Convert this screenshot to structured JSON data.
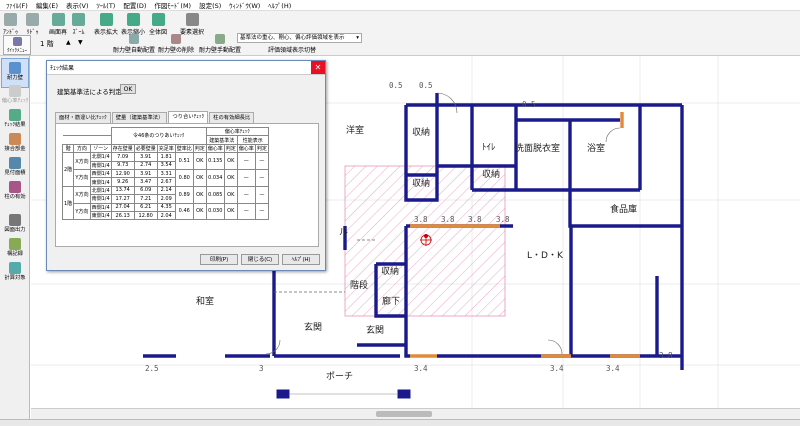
{
  "menu": [
    "ﾌｧｲﾙ(F)",
    "編集(E)",
    "表示(V)",
    "ﾂｰﾙ(T)",
    "配置(D)",
    "作図ﾓｰﾄﾞ(M)",
    "設定(S)",
    "ｳｨﾝﾄﾞｳ(W)",
    "ﾍﾙﾌﾟ(H)"
  ],
  "toolbar": {
    "undo": "ｱﾝﾄﾞｩ",
    "redo": "ﾘﾄﾞｩ",
    "redraw": "画面再",
    "zoom": "ｽﾞｰﾑ",
    "zoom_in": "表示拡大",
    "zoom_out": "表示縮小",
    "fit": "全体図",
    "select": "要素選択",
    "quick_menu": "ｸｲｯｸﾒﾆｭｰ",
    "floor": "1 階",
    "bearing_auto": "耐力壁自動配置",
    "bearing_delete": "耐力壁の削除",
    "bearing_manual": "耐力壁手動配置",
    "display_select": "基準法の重心、剛心、偏心評価領域を表示",
    "display_switch": "評価領域表示切替"
  },
  "left_panel": [
    {
      "label": "耐力壁",
      "active": true
    },
    {
      "label": "偏心率ﾁｪｯｸ",
      "active": false
    },
    {
      "label": "ﾁｪｯｸ結果",
      "active": false
    },
    {
      "label": "接合部金",
      "active": false
    },
    {
      "label": "見付面積",
      "active": false
    },
    {
      "label": "柱の有効",
      "active": false
    },
    {
      "label": "図面出力",
      "active": false
    },
    {
      "label": "構記録",
      "active": false
    },
    {
      "label": "計算対象",
      "active": false
    }
  ],
  "dialog": {
    "title": "ﾁｪｯｸ結果",
    "close": "✕",
    "law_label": "建築基準法による判定",
    "law_result": "OK",
    "tabs": [
      "面材・筋違い比ﾁｪｯｸ",
      "壁量（建築基準法）",
      "つり合いﾁｪｯｸ",
      "柱の有効細長比"
    ],
    "selected_tab": 2,
    "table": {
      "h_group1": "令46条のつりあいﾁｪｯｸ",
      "h_group2": "偏心率ﾁｪｯｸ",
      "h_sub2a": "建築基準法",
      "h_sub2b": "性能表示",
      "cols": [
        "階",
        "方向",
        "ゾーン",
        "存在壁量",
        "必要壁量",
        "充足率",
        "壁率比",
        "判定",
        "偏心率",
        "判定",
        "偏心率",
        "判定"
      ],
      "rows": [
        [
          "2階",
          "X方向",
          "北側1/4",
          "7.09",
          "3.91",
          "1.81",
          "0.51",
          "OK",
          "0.135",
          "OK",
          "—",
          "—"
        ],
        [
          "",
          "",
          "南側1/4",
          "9.73",
          "2.74",
          "3.54",
          "",
          "",
          "",
          "",
          "",
          ""
        ],
        [
          "",
          "Y方向",
          "西側1/4",
          "12.90",
          "3.91",
          "3.31",
          "0.80",
          "OK",
          "0.034",
          "OK",
          "—",
          "—"
        ],
        [
          "",
          "",
          "東側1/4",
          "9.26",
          "3.47",
          "2.67",
          "",
          "",
          "",
          "",
          "",
          ""
        ],
        [
          "1階",
          "X方向",
          "北側1/4",
          "13.74",
          "6.09",
          "2.14",
          "0.89",
          "OK",
          "0.085",
          "OK",
          "—",
          "—"
        ],
        [
          "",
          "",
          "南側1/4",
          "17.27",
          "7.21",
          "2.09",
          "",
          "",
          "",
          "",
          "",
          ""
        ],
        [
          "",
          "Y方向",
          "西側1/4",
          "27.04",
          "6.21",
          "4.35",
          "0.46",
          "OK",
          "0.030",
          "OK",
          "—",
          "—"
        ],
        [
          "",
          "",
          "東側1/4",
          "26.13",
          "12.80",
          "2.04",
          "",
          "",
          "",
          "",
          "",
          ""
        ]
      ]
    },
    "btn_print": "印刷(P)",
    "btn_close": "閉じる(C)",
    "btn_help": "ﾍﾙﾌﾟ(H)"
  },
  "plan": {
    "rooms": {
      "youshitsu": "洋室",
      "shuno1": "収納",
      "toilet": "ﾄｲﾚ",
      "senmen": "洗面脱衣室",
      "yokushitsu": "浴室",
      "shuno2": "収納",
      "shuno3": "収納",
      "shokuhinko": "食品庫",
      "ldk": "L・D・K",
      "shuno4": "収納",
      "kaidan": "階段",
      "rouka": "廊下",
      "genkan1": "玄関",
      "genkan2": "玄関",
      "washitsu": "和室",
      "porch": "ポーチ",
      "ru": "ル"
    },
    "dims": {
      "d05a": "0.5",
      "d05b": "0.5",
      "d05c": "0.5",
      "d38a": "3.8",
      "d38b": "3.8",
      "d38c": "3.8",
      "d38d": "3.8",
      "d38e": "3.8",
      "d25": "2.5",
      "d3a": "3",
      "d34a": "3.4",
      "d34b": "3.4",
      "d34c": "3.4"
    }
  },
  "colors": {
    "wall": "#1a1a8c",
    "accent": "#e08a3a",
    "hatch": "#e070a0"
  }
}
